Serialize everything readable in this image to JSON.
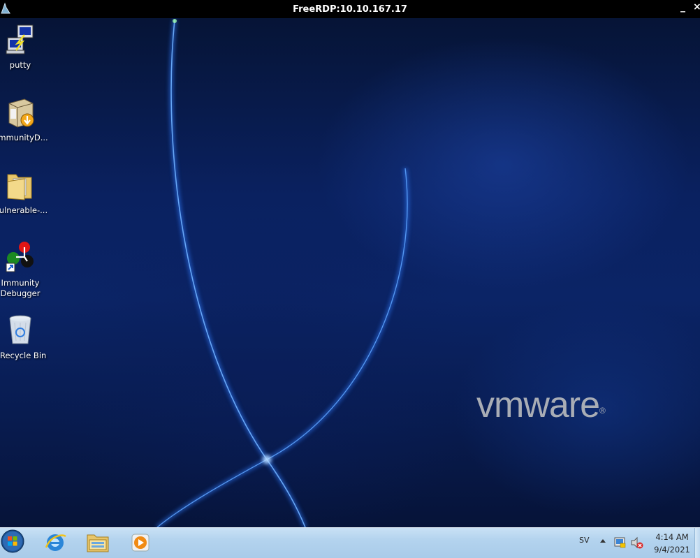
{
  "window": {
    "title": "FreeRDP:10.10.167.17",
    "minimize_label": "_",
    "close_label": "×"
  },
  "desktop": {
    "icons": [
      {
        "label": "putty",
        "icon": "putty-icon"
      },
      {
        "label": "ImmunityD...",
        "icon": "installer-icon"
      },
      {
        "label": "vulnerable-...",
        "icon": "folder-icon"
      },
      {
        "label": "Immunity Debugger",
        "icon": "immunity-debugger-icon"
      },
      {
        "label": "Recycle Bin",
        "icon": "recycle-bin-icon"
      }
    ],
    "wallpaper_brand": "vmware",
    "wallpaper_brand_mark": "®"
  },
  "taskbar": {
    "pinned": [
      {
        "name": "internet-explorer-icon"
      },
      {
        "name": "file-explorer-icon"
      },
      {
        "name": "media-player-icon"
      }
    ],
    "language": "SV",
    "tray_icons": [
      "show-hidden-icons-arrow",
      "network-icon",
      "volume-muted-icon"
    ],
    "clock_time": "4:14 AM",
    "clock_date": "9/4/2021"
  },
  "colors": {
    "titlebar": "#000000",
    "taskbar": "#b3d3ee",
    "desktop_blue": "#0b2466",
    "logo_gray": "#a9adb5"
  }
}
